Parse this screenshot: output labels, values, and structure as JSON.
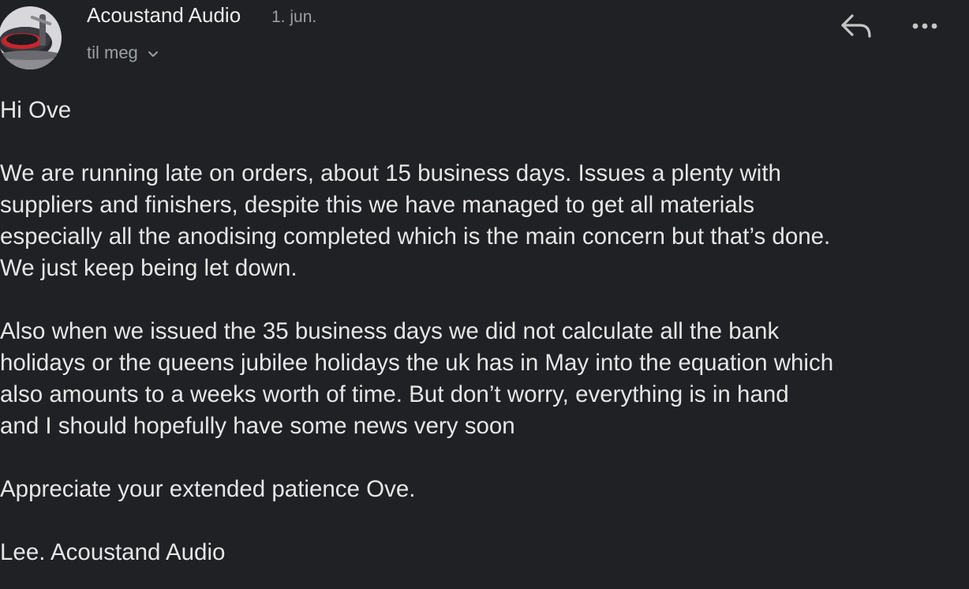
{
  "email": {
    "sender": {
      "name": "Acoustand Audio",
      "avatar_icon": "turntable-avatar"
    },
    "date": "1. jun.",
    "recipient_label": "til meg",
    "actions": {
      "reply_icon": "reply-icon",
      "more_icon": "more-horizontal-icon"
    },
    "body": {
      "greeting": "Hi Ove",
      "paragraph1": [
        "We are running late on orders, about 15 business days. Issues a plenty with",
        "suppliers and finishers, despite this we have managed to get all materials",
        "especially all the anodising completed which is the main concern but that’s done.",
        "We just keep being let down."
      ],
      "paragraph2": [
        "Also when we issued the 35 business days we did not calculate all the bank",
        "holidays or the queens jubilee holidays the uk has in May into the equation which",
        "also amounts to a weeks worth of time. But don’t worry, everything is in hand",
        "and I should hopefully have some news very soon"
      ],
      "closing": "Appreciate your extended patience Ove.",
      "signature": "Lee.  Acoustand Audio"
    }
  },
  "colors": {
    "background": "#202124",
    "primary_text": "#e6e6e6",
    "secondary_text": "#9aa0a6"
  }
}
